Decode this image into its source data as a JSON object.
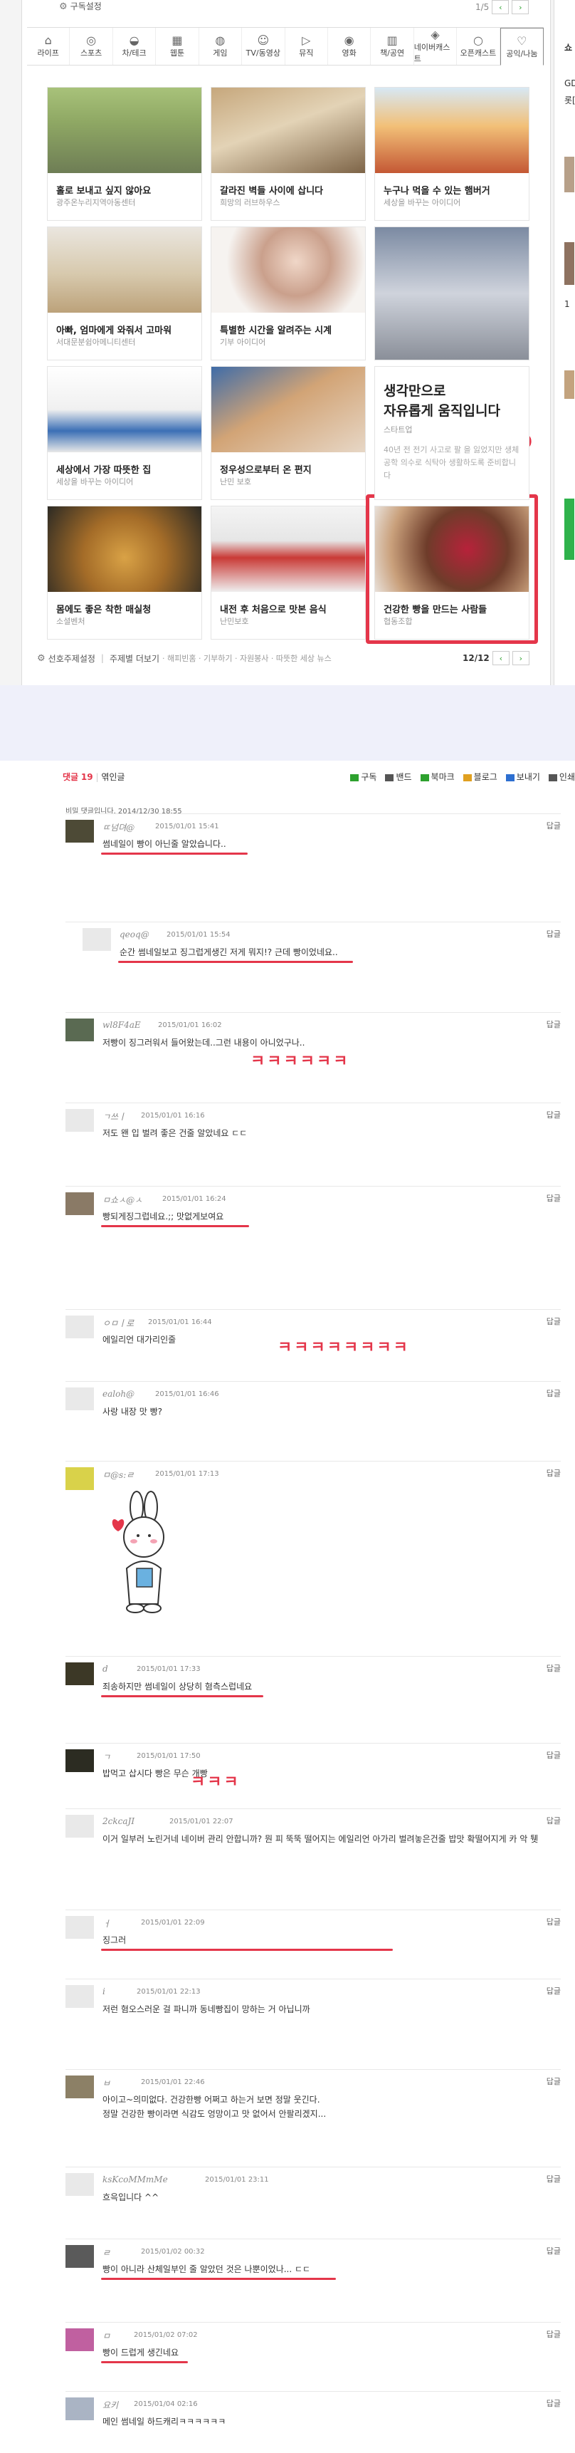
{
  "top": {
    "subscribe_settings": "구독설정",
    "subscribe_pager": "1/5",
    "tabs": [
      {
        "label": "라이프",
        "icon": "home-icon"
      },
      {
        "label": "스포츠",
        "icon": "ball-icon"
      },
      {
        "label": "차/테크",
        "icon": "car-icon"
      },
      {
        "label": "웹툰",
        "icon": "webtoon-icon"
      },
      {
        "label": "게임",
        "icon": "gamepad-icon"
      },
      {
        "label": "TV/동영상",
        "icon": "tv-icon"
      },
      {
        "label": "뮤직",
        "icon": "music-icon"
      },
      {
        "label": "영화",
        "icon": "film-icon"
      },
      {
        "label": "책/공연",
        "icon": "book-icon"
      },
      {
        "label": "네이버캐스트",
        "icon": "cast-icon"
      },
      {
        "label": "오픈캐스트",
        "icon": "opencast-icon"
      },
      {
        "label": "공익/나눔",
        "icon": "heart-icon"
      }
    ],
    "cards": [
      {
        "title": "홀로 보내고 싶지 않아요",
        "source": "광주온누리지역아동센터"
      },
      {
        "title": "갈라진 벽들 사이에 삽니다",
        "source": "희망의 러브하우스"
      },
      {
        "title": "누구나 먹을 수 있는 햄버거",
        "source": "세상을 바꾸는 아이디어"
      },
      {
        "title": "아빠, 엄마에게 와줘서 고마워",
        "source": "서대문분쉼아메니티센터"
      },
      {
        "title": "특별한 시간을 알려주는 시계",
        "source": "기부 아이디어"
      },
      {
        "title": "",
        "source": ""
      },
      {
        "title": "세상에서 가장 따뜻한 집",
        "source": "세상을 바꾸는 아이디어"
      },
      {
        "title": "정우성으로부터 온 편지",
        "source": "난민 보호"
      },
      {
        "title": "생각만으로\n자유롭게 움직입니다",
        "source": "스타트업",
        "desc": "40년 전 전기 사고로 팔 을 잃었지만 생체공학 의수로 식탁아 생활하도록 준비합니다"
      },
      {
        "title": "몸에도 좋은 착한 매실청",
        "source": "소셜벤처"
      },
      {
        "title": "내전 후 처음으로 맛본 음식",
        "source": "난민보호"
      },
      {
        "title": "건강한 빵을 만드는 사람들",
        "source": "협동조합"
      }
    ],
    "annotation_marks": "??",
    "bottom_bar": {
      "settings": "선호주제설정",
      "more": "주제별 더보기",
      "links": "· 해피빈홈 · 기부하기 · 자원봉사 · 따뜻한 세상 뉴스",
      "pager": "12/12"
    },
    "right_panel": {
      "label1": "쇼",
      "label2": "GD",
      "label3": "롯[",
      "label4": "1"
    }
  },
  "comments_section": {
    "header": {
      "title_prefix": "댓글",
      "count": "19",
      "title_suffix": "엮인글"
    },
    "actions": [
      "구독",
      "밴드",
      "북마크",
      "블로그",
      "보내기",
      "인쇄"
    ],
    "secret": "비밀 댓글입니다.   2014/12/30 18:55",
    "reply_label": "답글",
    "items": [
      {
        "nick": "ㄸ넘뎌@",
        "date": "2015/01/01 15:41",
        "text": "썸네일이 빵이 아닌줄 알았습니다.."
      },
      {
        "nick": "qeoq@",
        "date": "2015/01/01 15:54",
        "text": "순간 썸네일보고 징그럽게생긴 저게 뭐지!? 근데 빵이었네요.."
      },
      {
        "nick": "wl8F4aE",
        "date": "2015/01/01 16:02",
        "text": "저빵이 징그러워서 들어왔는데..그런 내용이 아니었구나.."
      },
      {
        "nick": "ㄱ쓰ㅣ",
        "date": "2015/01/01 16:16",
        "text": "저도 왠 입 벌려 좋은 건줄 알았네요 ㄷㄷ"
      },
      {
        "nick": "ㅁ쇼ㅅ@ㅅ",
        "date": "2015/01/01 16:24",
        "text": "빵되게징그럽네요.;; 맛없게보여요"
      },
      {
        "nick": "ㅇㅁㅣ로",
        "date": "2015/01/01 16:44",
        "text": "에일리언 대가리인줄"
      },
      {
        "nick": "ealoh@",
        "date": "2015/01/01 16:46",
        "text": "사랑 내장 맛 빵?"
      },
      {
        "nick": "ㅁ@s:ㄹ",
        "date": "2015/01/01 17:13",
        "text": ""
      },
      {
        "nick": "d",
        "date": "2015/01/01 17:33",
        "text": "죄송하지만 썸네일이 상당히 혐측스럽네요"
      },
      {
        "nick": "ㄱ",
        "date": "2015/01/01 17:50",
        "text": "밥먹고 삽시다 빵은 무슨 개빵"
      },
      {
        "nick": "2ckcaJI",
        "date": "2015/01/01 22:07",
        "text": "이거 일부러 노린거네 네이버 관리 안합니까? 뭔 피 뚝뚝 떨어지는 에일리언 아가리 벌려놓은건줄 밥맛 확떨어지게 카 악 퉷"
      },
      {
        "nick": "ㅓ",
        "date": "2015/01/01 22:09",
        "text": "징그러"
      },
      {
        "nick": "i",
        "date": "2015/01/01 22:13",
        "text": "저런 혐오스러운 걸 파니까 동네빵집이 망하는 거 아닙니까"
      },
      {
        "nick": "ㅂ",
        "date": "2015/01/01 22:46",
        "text": "아이고~의미없다. 건강한빵 어쩌고 하는거 보면 정말 웃긴다.\n정말 건강한 빵이라면 식감도 엉망이고 맛 없어서 안팔리겠지..."
      },
      {
        "nick": "ksKcoMMmMe",
        "date": "2015/01/01 23:11",
        "text": "흐윽입니다 ^^"
      },
      {
        "nick": "ㄹ",
        "date": "2015/01/02 00:32",
        "text": "빵이 아니라 산체일부인 줄 알았던 것은 나뿐이었나... ㄷㄷ"
      },
      {
        "nick": "ㅁ",
        "date": "2015/01/02 07:02",
        "text": "빵이 드럽게 생긴네요"
      },
      {
        "nick": "요키",
        "date": "2015/01/04 02:16",
        "text": "메인 썸네일 하드캐리ㅋㅋㅋㅋㅋㅋ"
      }
    ],
    "laughs": [
      "ㅋㅋㅋㅋㅋㅋ",
      "ㅋㅋㅋㅋㅋㅋㅋㅋ",
      "ㅋㅋㅋ"
    ]
  }
}
